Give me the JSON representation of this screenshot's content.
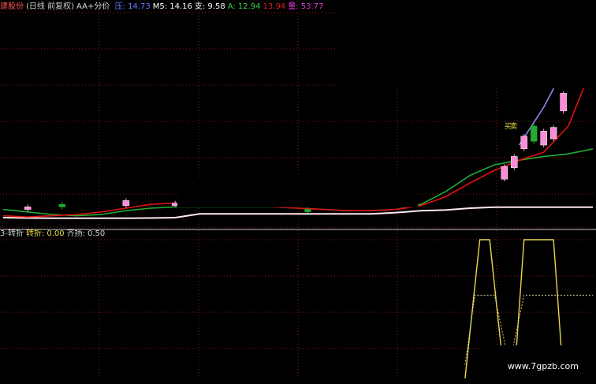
{
  "header": {
    "stock_name": "建股份",
    "period": "(日线 前复权)",
    "indicator": "AA+分价",
    "items": [
      {
        "label": "压:",
        "value": "14.73",
        "color": "#6a7cff"
      },
      {
        "label": "M5:",
        "value": "14.16",
        "color": "#ffffff"
      },
      {
        "label": "支:",
        "value": "9.58",
        "color": "#ffffff"
      },
      {
        "label": "A:",
        "value": "12.94",
        "color": "#39d24b"
      },
      {
        "label": "",
        "value": "13.94",
        "color": "#e02020"
      },
      {
        "label": "量:",
        "value": "53.77",
        "color": "#e03bdc"
      }
    ]
  },
  "subheader": {
    "prefix": "3-转折",
    "turn_label": "转折:",
    "turn_value": "0.00",
    "rise_label": "齐扬:",
    "rise_value": "0.50"
  },
  "watermark": "www.7gpzb.com",
  "colors": {
    "pink": "#ff8ad8",
    "green": "#22aa33",
    "red": "#e01010",
    "blue": "#8a8cf0",
    "yellow": "#e8d84a",
    "white": "#ffe8ee",
    "grid": "#8b1a1a"
  },
  "annotations": [
    {
      "text": "买",
      "color": "#e8d84a"
    },
    {
      "text": "卖",
      "color": "#e8d84a"
    }
  ],
  "chart_data": {
    "type": "line",
    "x": [
      0,
      5,
      10,
      15,
      20,
      25,
      30,
      35,
      40,
      45,
      50,
      55,
      60,
      65,
      70,
      75,
      80,
      85,
      90,
      95,
      100,
      105,
      110,
      115,
      120
    ],
    "series": [
      {
        "name": "压",
        "color": "#8a8cf0",
        "values": [
          null,
          null,
          null,
          null,
          null,
          null,
          null,
          null,
          null,
          null,
          null,
          null,
          null,
          null,
          null,
          null,
          null,
          null,
          null,
          null,
          null,
          14.5,
          17.5,
          21.2,
          25
        ]
      },
      {
        "name": "支",
        "color": "#ffe8ee",
        "values": [
          8.75,
          8.72,
          8.7,
          8.7,
          8.7,
          8.7,
          8.72,
          8.75,
          9.05,
          9.05,
          9.05,
          9.05,
          9.05,
          9.05,
          9.05,
          9.05,
          9.15,
          9.3,
          9.35,
          9.5,
          9.58,
          9.58,
          9.58,
          9.58,
          9.58
        ]
      },
      {
        "name": "A",
        "color": "#22aa33",
        "values": [
          9.4,
          9.2,
          9.0,
          8.9,
          9.0,
          9.3,
          9.5,
          9.6,
          9.6,
          9.6,
          9.6,
          9.6,
          9.5,
          9.4,
          9.3,
          9.3,
          9.4,
          9.8,
          10.8,
          12.1,
          12.94,
          13.3,
          13.6,
          13.8,
          14.2
        ]
      },
      {
        "name": "red",
        "color": "#e01010",
        "values": [
          8.9,
          8.8,
          8.9,
          9.0,
          9.2,
          9.5,
          9.8,
          9.9,
          9.9,
          9.8,
          9.7,
          9.6,
          9.5,
          9.4,
          9.3,
          9.3,
          9.4,
          9.7,
          10.4,
          11.5,
          12.5,
          13.3,
          13.94,
          16.0,
          20.8
        ]
      }
    ],
    "candles": [
      {
        "x": 5,
        "o": 9.4,
        "c": 9.6,
        "up": true
      },
      {
        "x": 12,
        "o": 9.8,
        "c": 9.6,
        "up": false
      },
      {
        "x": 25,
        "o": 9.7,
        "c": 10.1,
        "up": true
      },
      {
        "x": 35,
        "o": 9.8,
        "c": 9.9,
        "up": true
      },
      {
        "x": 62,
        "o": 9.4,
        "c": 9.3,
        "up": false
      },
      {
        "x": 102,
        "o": 11.8,
        "c": 12.8,
        "up": true
      },
      {
        "x": 104,
        "o": 12.7,
        "c": 13.6,
        "up": true
      },
      {
        "x": 106,
        "o": 14.2,
        "c": 15.2,
        "up": true
      },
      {
        "x": 108,
        "o": 16.0,
        "c": 14.8,
        "up": false
      },
      {
        "x": 110,
        "o": 14.5,
        "c": 15.6,
        "up": true
      },
      {
        "x": 112,
        "o": 15.0,
        "c": 15.9,
        "up": true
      },
      {
        "x": 114,
        "o": 17.2,
        "c": 18.6,
        "up": true
      },
      {
        "x": 116,
        "o": 21.4,
        "c": 23.0,
        "up": true
      }
    ],
    "ylim": [
      8,
      25
    ],
    "indicator": {
      "turn": [
        {
          "x": 94,
          "y": 0
        },
        {
          "x": 97,
          "y": 1
        },
        {
          "x": 99,
          "y": 1
        },
        {
          "x": 102,
          "y": 0
        },
        {
          "x": 104,
          "y": 0
        },
        {
          "x": 106,
          "y": 1
        },
        {
          "x": 112,
          "y": 1
        },
        {
          "x": 114,
          "y": 0
        }
      ],
      "rise": [
        {
          "x": 94,
          "y": 0.1
        },
        {
          "x": 96,
          "y": 0.6
        },
        {
          "x": 100,
          "y": 0.6
        },
        {
          "x": 103,
          "y": 0.1
        },
        {
          "x": 106,
          "y": 0.6
        },
        {
          "x": 120,
          "y": 0.6
        }
      ],
      "ylim": [
        0,
        1
      ]
    }
  }
}
